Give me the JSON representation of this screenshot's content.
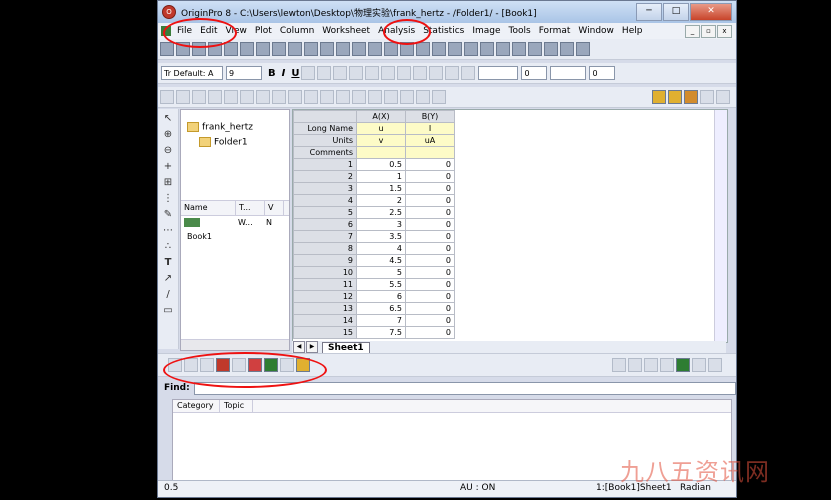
{
  "window": {
    "title": "OriginPro 8 - C:\\Users\\lewton\\Desktop\\物理实验\\frank_hertz - /Folder1/ - [Book1]",
    "min": "─",
    "max": "□",
    "close": "✕"
  },
  "menu": [
    "File",
    "Edit",
    "View",
    "Plot",
    "Column",
    "Worksheet",
    "Analysis",
    "Statistics",
    "Image",
    "Tools",
    "Format",
    "Window",
    "Help"
  ],
  "mdi": [
    "_",
    "▫",
    "x"
  ],
  "format_toolbar": {
    "font": "Tr Default: A",
    "size": "9",
    "bold": "B",
    "italic": "I",
    "underline": "U",
    "line_value1": "0",
    "line_value2": "0"
  },
  "explorer": {
    "root": "frank_hertz",
    "child": "Folder1",
    "col_name": "Name",
    "col_type": "T...",
    "col_v": "V",
    "item_name": "Book1",
    "item_type": "W...",
    "item_v": "N"
  },
  "worksheet": {
    "col_a": "A(X)",
    "col_b": "B(Y)",
    "label_long": "Long Name",
    "label_units": "Units",
    "label_comments": "Comments",
    "a_long": "u",
    "b_long": "I",
    "a_units": "v",
    "b_units": "uA",
    "rows": [
      [
        "1",
        "0.5",
        "0"
      ],
      [
        "2",
        "1",
        "0"
      ],
      [
        "3",
        "1.5",
        "0"
      ],
      [
        "4",
        "2",
        "0"
      ],
      [
        "5",
        "2.5",
        "0"
      ],
      [
        "6",
        "3",
        "0"
      ],
      [
        "7",
        "3.5",
        "0"
      ],
      [
        "8",
        "4",
        "0"
      ],
      [
        "9",
        "4.5",
        "0"
      ],
      [
        "10",
        "5",
        "0"
      ],
      [
        "11",
        "5.5",
        "0"
      ],
      [
        "12",
        "6",
        "0"
      ],
      [
        "13",
        "6.5",
        "0"
      ],
      [
        "14",
        "7",
        "0"
      ],
      [
        "15",
        "7.5",
        "0"
      ]
    ],
    "sheet_tab": "Sheet1"
  },
  "find": {
    "label": "Find:",
    "col_category": "Category",
    "col_topic": "Topic"
  },
  "status": {
    "left": "0.5",
    "au": "AU : ON",
    "sheet": "1:[Book1]Sheet1",
    "angle": "Radian"
  },
  "watermark": "九八五资讯网"
}
